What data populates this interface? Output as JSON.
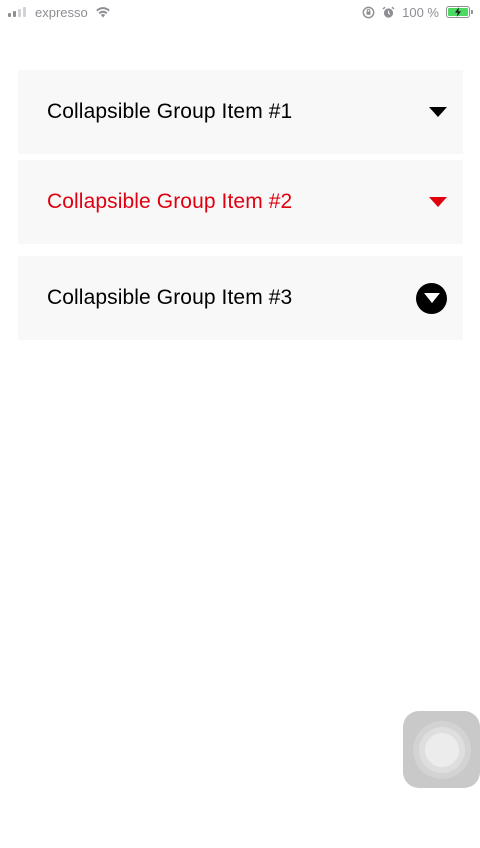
{
  "status_bar": {
    "carrier": "expresso",
    "battery_percent": "100 %",
    "battery_level": 1.0,
    "icons": [
      "signal-icon",
      "wifi-icon",
      "orientation-lock-icon",
      "alarm-icon",
      "battery-charging-icon"
    ]
  },
  "collapsible": {
    "items": [
      {
        "label": "Collapsible Group Item #1",
        "icon": "chevron-down-icon",
        "active": false
      },
      {
        "label": "Collapsible Group Item #2",
        "icon": "chevron-down-icon",
        "active": true
      },
      {
        "label": "Collapsible Group Item #3",
        "icon": "circle-chevron-down-icon",
        "active": false
      }
    ]
  },
  "colors": {
    "active": "#e0000f",
    "text": "#000000",
    "item_background": "#f8f8f8",
    "background": "#ffffff",
    "status_text": "#8e8e93",
    "battery_fill": "#4cd964"
  },
  "assistive_touch": {
    "icon": "assistive-touch-icon"
  }
}
